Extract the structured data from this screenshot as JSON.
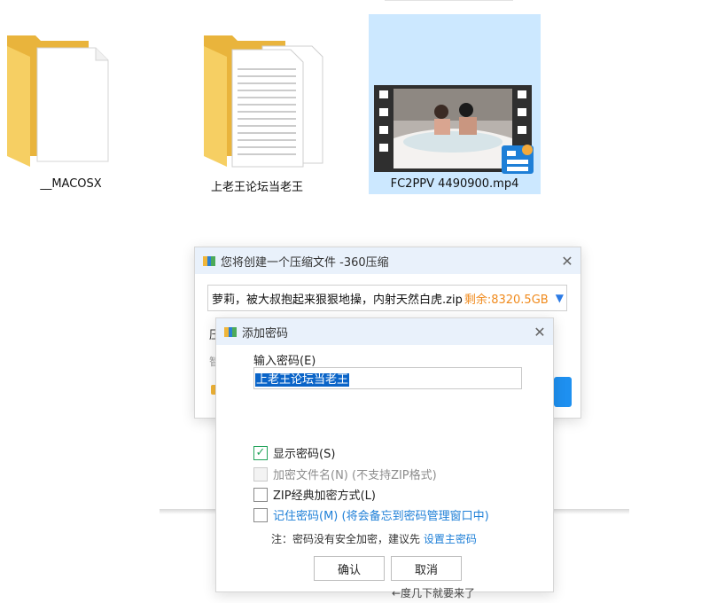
{
  "desktop": {
    "items": [
      {
        "label": "__MACOSX",
        "icon": "folder-icon"
      },
      {
        "label": "上老王论坛当老王",
        "icon": "folder-with-documents-icon"
      },
      {
        "label": "FC2PPV 4490900.mp4",
        "icon": "video-file-icon",
        "selected": true
      }
    ]
  },
  "compress_window": {
    "title": "您将创建一个压缩文件 -360压缩",
    "close_icon": "close-icon",
    "filename": "萝莉，被大叔抱起来狠狠地操，内射天然白虎.zip",
    "free_space": "剩余:8320.5GB",
    "side_char_1": "压",
    "side_char_2": "智"
  },
  "password_dialog": {
    "title": "添加密码",
    "password_label": "输入密码(E)",
    "password_value": "上老王论坛当老王",
    "options": [
      {
        "label": "显示密码(S)",
        "checked": true,
        "enabled": true
      },
      {
        "label": "加密文件名(N) (不支持ZIP格式)",
        "checked": false,
        "enabled": false
      },
      {
        "label": "ZIP经典加密方式(L)",
        "checked": false,
        "enabled": true
      },
      {
        "label": "记住密码(M) (将会备忘到密码管理窗口中)",
        "checked": false,
        "enabled": true
      }
    ],
    "note_prefix": "注：密码没有安全加密，建议先 ",
    "note_link": "设置主密码",
    "ok_label": "确认",
    "cancel_label": "取消"
  },
  "bottom_fragment": "←度几下就要来了",
  "colors": {
    "selection": "#cce8ff",
    "titlebar": "#e9f1fb",
    "accent_blue": "#1e7fd7",
    "free_space_orange": "#f08a1c",
    "check_green": "#22a35a"
  }
}
